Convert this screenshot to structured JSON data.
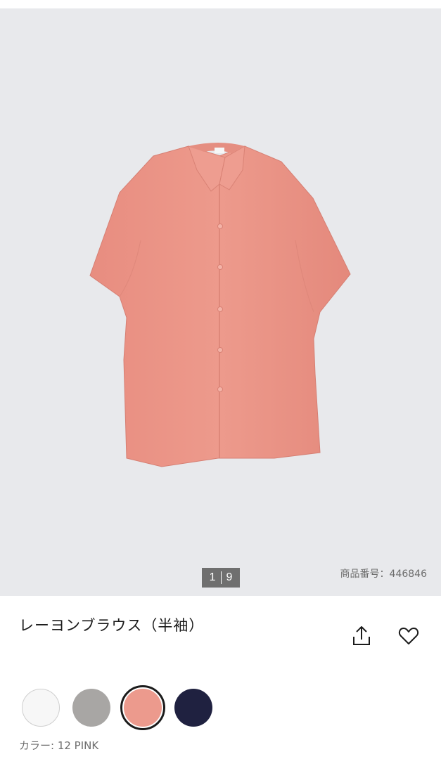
{
  "gallery": {
    "current": "1",
    "total": "9",
    "product_code": "商品番号：446846",
    "background_color": "#e8e9ec"
  },
  "product": {
    "title": "レーヨンブラウス（半袖）",
    "garment_color": "#eb9688"
  },
  "actions": {
    "share_icon": "share-icon",
    "favorite_icon": "heart-icon"
  },
  "colors": {
    "swatches": [
      {
        "name": "white",
        "hex": "#f7f7f7"
      },
      {
        "name": "gray",
        "hex": "#a8a6a4"
      },
      {
        "name": "pink",
        "hex": "#ec9a8d",
        "selected": true
      },
      {
        "name": "navy",
        "hex": "#1f2140"
      }
    ],
    "selected_label": "カラー: 12 PINK"
  }
}
